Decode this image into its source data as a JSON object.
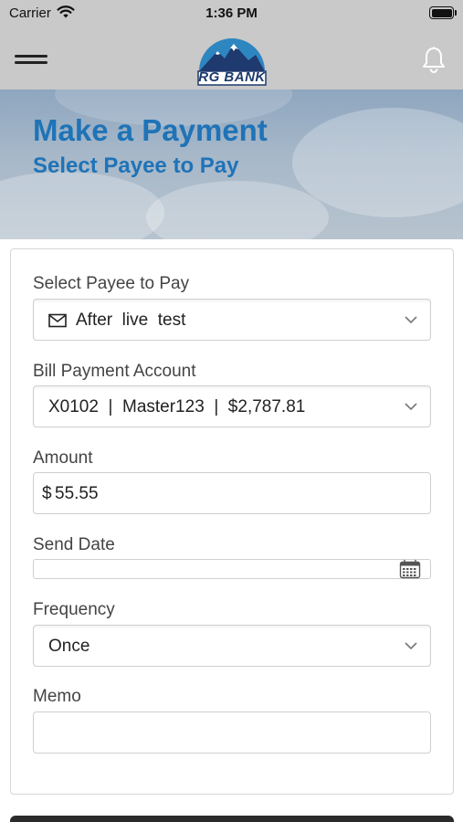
{
  "status_bar": {
    "carrier": "Carrier",
    "time": "1:36 PM",
    "icons": [
      "wifi-icon",
      "battery-icon"
    ]
  },
  "nav": {
    "logo_text": "RG BANK",
    "icons": [
      "menu-icon",
      "bell-icon"
    ]
  },
  "hero": {
    "title": "Make a Payment",
    "subtitle": "Select Payee to Pay"
  },
  "form": {
    "payee": {
      "label": "Select Payee to Pay",
      "value": "After  live  test",
      "icon": "envelope-icon"
    },
    "account": {
      "label": "Bill Payment Account",
      "value": "X0102  |  Master123  |  $2,787.81"
    },
    "amount": {
      "label": "Amount",
      "prefix": "$",
      "value": "55.55"
    },
    "send_date": {
      "label": "Send Date",
      "value": "",
      "icon": "calendar-icon"
    },
    "frequency": {
      "label": "Frequency",
      "value": "Once"
    },
    "memo": {
      "label": "Memo",
      "value": ""
    }
  },
  "colors": {
    "accent": "#1f73b7",
    "nav_background": "#c9c9c9",
    "logo_navy": "#1e3a6e",
    "logo_sky": "#2e86c1"
  }
}
